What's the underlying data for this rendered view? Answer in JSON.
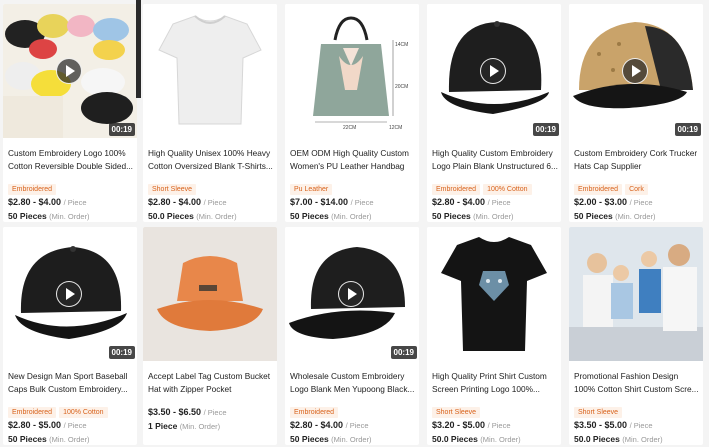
{
  "price_unit": "/ Piece",
  "moq_unit": "(Min. Order)",
  "products": [
    {
      "title": "Custom Embroidery Logo 100% Cotton Reversible Double Sided...",
      "tags": [
        "Embroidered"
      ],
      "price": "$2.80 - $4.00",
      "moq": "50 Pieces",
      "duration": "00:19",
      "video": true,
      "image_icon": "assorted-caps-image"
    },
    {
      "title": "High Quality Unisex 100% Heavy Cotton Oversized Blank T-Shirts...",
      "tags": [
        "Short Sleeve"
      ],
      "price": "$2.80 - $4.00",
      "moq": "50.0 Pieces",
      "duration": "",
      "video": false,
      "image_icon": "white-tshirt-image"
    },
    {
      "title": "OEM ODM High Quality Custom Women's PU Leather Handbag",
      "tags": [
        "Pu Leather"
      ],
      "price": "$7.00 - $14.00",
      "moq": "50 Pieces",
      "duration": "",
      "video": false,
      "image_icon": "handbag-image",
      "dims": [
        "14CM",
        "20CM",
        "22CM",
        "12CM"
      ]
    },
    {
      "title": "High Quality Custom Embroidery Logo Plain Blank Unstructured 6...",
      "tags": [
        "Embroidered",
        "100% Cotton"
      ],
      "price": "$2.80 - $4.00",
      "moq": "50 Pieces",
      "duration": "00:19",
      "video": true,
      "image_icon": "black-cap-image"
    },
    {
      "title": "Custom Embroidery Cork Trucker Hats Cap Supplier",
      "tags": [
        "Embroidered",
        "Cork"
      ],
      "price": "$2.00 - $3.00",
      "moq": "50 Pieces",
      "duration": "00:19",
      "video": true,
      "image_icon": "cork-trucker-cap-image"
    },
    {
      "title": "New Design Man Sport Baseball Caps Bulk Custom Embroidery...",
      "tags": [
        "Embroidered",
        "100% Cotton"
      ],
      "price": "$2.80 - $5.00",
      "moq": "50 Pieces",
      "duration": "00:19",
      "video": true,
      "image_icon": "black-baseball-cap-image"
    },
    {
      "title": "Accept Label Tag Custom Bucket Hat with Zipper Pocket",
      "tags": [],
      "price": "$3.50 - $6.50",
      "moq": "1 Piece",
      "duration": "",
      "video": false,
      "image_icon": "orange-bucket-hat-image"
    },
    {
      "title": "Wholesale Custom Embroidery Logo Blank Men Yupoong Black...",
      "tags": [
        "Embroidered"
      ],
      "price": "$2.80 - $4.00",
      "moq": "50 Pieces",
      "duration": "00:19",
      "video": true,
      "image_icon": "black-snapback-image"
    },
    {
      "title": "High Quality Print Shirt Custom Screen Printing Logo 100%...",
      "tags": [
        "Short Sleeve"
      ],
      "price": "$3.20 - $5.00",
      "moq": "50.0 Pieces",
      "duration": "",
      "video": false,
      "image_icon": "tiger-print-tshirt-image"
    },
    {
      "title": "Promotional Fashion Design 100% Cotton Shirt Custom Scre...",
      "tags": [
        "Short Sleeve"
      ],
      "price": "$3.50 - $5.00",
      "moq": "50.0 Pieces",
      "duration": "",
      "video": false,
      "image_icon": "family-tshirts-image"
    }
  ]
}
